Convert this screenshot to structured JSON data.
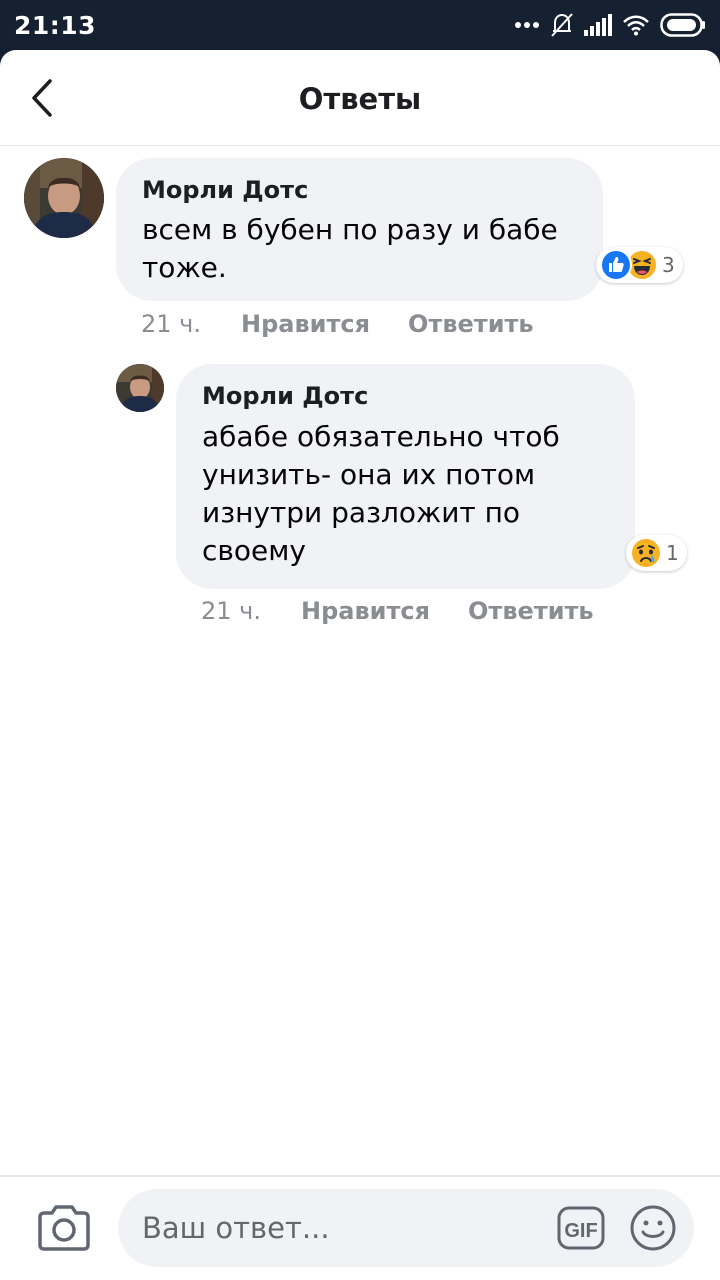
{
  "status_bar": {
    "time": "21:13"
  },
  "header": {
    "title": "Ответы"
  },
  "comments": [
    {
      "author": "Морли Дотс",
      "text": "всем в бубен  по разу и бабе\nтоже.",
      "time": "21 ч.",
      "like_label": "Нравится",
      "reply_label": "Ответить",
      "reaction_count": "3",
      "reactions": [
        "like-icon",
        "haha-icon"
      ]
    },
    {
      "author": "Морли Дотс",
      "text": "абабе обязательно чтоб\nунизить- она их потом\nизнутри разложит по\nсвоему",
      "time": "21 ч.",
      "like_label": "Нравится",
      "reply_label": "Ответить",
      "reaction_count": "1",
      "reactions": [
        "sad-icon"
      ]
    }
  ],
  "compose": {
    "placeholder": "Ваш ответ..."
  },
  "colors": {
    "status_bar": "#152031",
    "bubble": "#f0f2f5",
    "like_blue": "#1877f2",
    "meta_gray": "#8a8d91"
  }
}
